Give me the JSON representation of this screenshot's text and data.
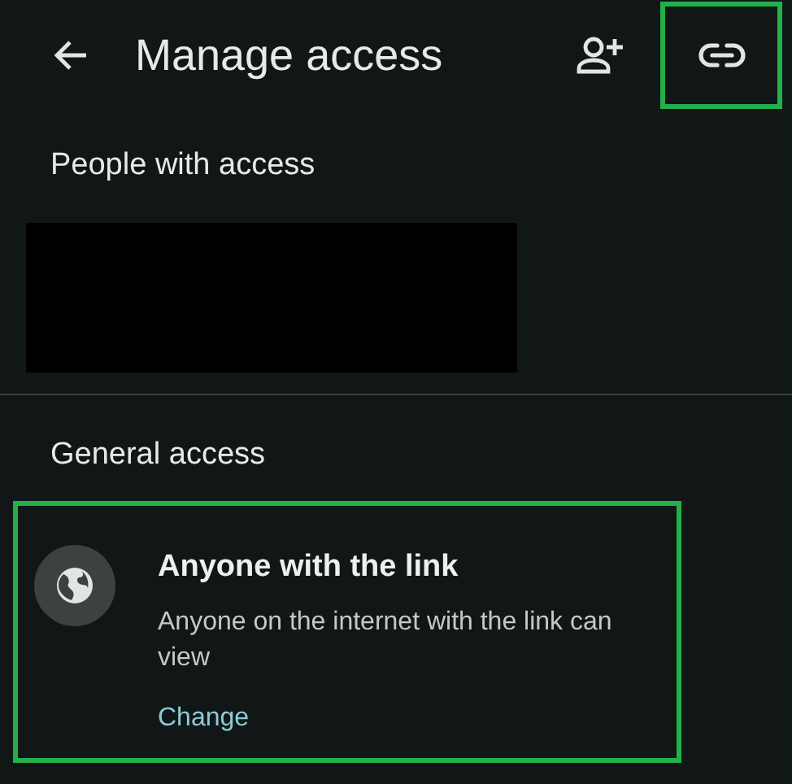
{
  "app_bar": {
    "title": "Manage access",
    "actions": [
      {
        "kind": "add-person",
        "highlighted": false
      },
      {
        "kind": "link",
        "highlighted": true
      }
    ]
  },
  "people_section": {
    "heading": "People with access",
    "redacted": true
  },
  "general_section": {
    "heading": "General access",
    "item": {
      "title": "Anyone with the link",
      "description": "Anyone on the internet with the link can view",
      "action": "Change",
      "highlighted": true
    }
  }
}
